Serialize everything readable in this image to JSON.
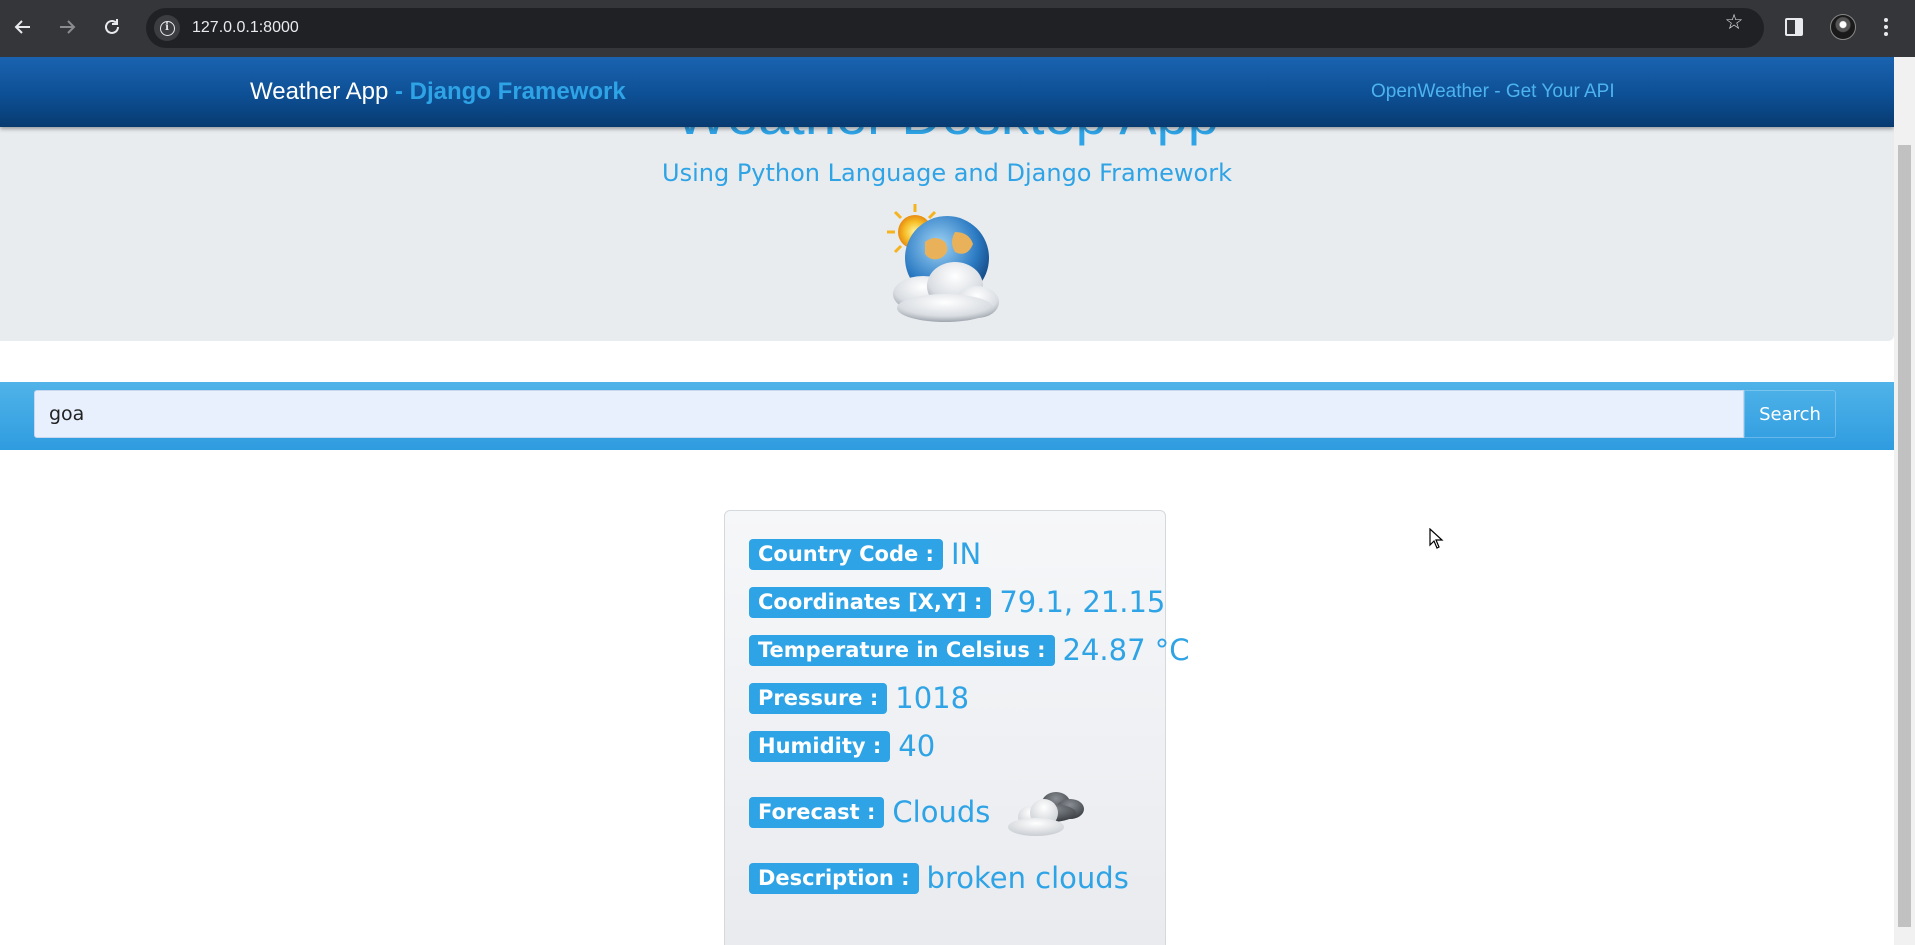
{
  "browser": {
    "url": "127.0.0.1:8000",
    "icons": [
      "back-arrow-icon",
      "forward-arrow-icon",
      "reload-icon",
      "site-info-icon",
      "bookmark-star-icon",
      "side-panel-icon",
      "profile-avatar",
      "menu-icon"
    ]
  },
  "navbar": {
    "brand": "Weather App",
    "brand_suffix": " - Django Framework",
    "link": "OpenWeather - Get Your API"
  },
  "hero": {
    "title": "Weather Desktop App",
    "subtitle": "Using Python Language and Django Framework",
    "logo_icon": "sun-globe-clouds-icon"
  },
  "search": {
    "value": "goa",
    "button_label": "Search"
  },
  "result": {
    "country_label": "Country Code :",
    "country_value": "IN",
    "coordinates_label": "Coordinates [X,Y] :",
    "coordinates_value": "79.1, 21.15",
    "temperature_label": "Temperature in Celsius :",
    "temperature_value": "24.87 °C",
    "pressure_label": "Pressure :",
    "pressure_value": "1018",
    "humidity_label": "Humidity :",
    "humidity_value": "40",
    "forecast_label": "Forecast :",
    "forecast_value": "Clouds",
    "forecast_icon": "cloud-icon",
    "description_label": "Description :",
    "description_value": "broken clouds"
  },
  "colors": {
    "accent": "#2ea3e5",
    "navbar": "#0d4f94",
    "hero_bg": "#e9ecef",
    "chrome": "#35363a"
  }
}
